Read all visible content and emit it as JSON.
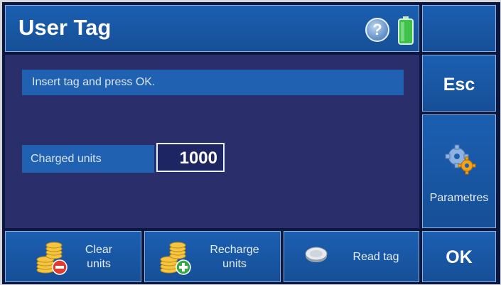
{
  "header": {
    "title": "User Tag",
    "help_symbol": "?",
    "icons": [
      "help-icon",
      "battery-icon"
    ]
  },
  "main": {
    "message": "Insert tag and press OK.",
    "charged_label": "Charged units",
    "charged_value": "1000"
  },
  "side": {
    "esc_label": "Esc",
    "parameters_label": "Parametres",
    "ok_label": "OK"
  },
  "bottom": {
    "clear_label_1": "Clear",
    "clear_label_2": "units",
    "recharge_label_1": "Recharge",
    "recharge_label_2": "units",
    "read_label": "Read tag"
  },
  "colors": {
    "button_blue": "#1b5fb1",
    "panel_navy": "#2a2f6b",
    "accent_green": "#3ec24a"
  }
}
